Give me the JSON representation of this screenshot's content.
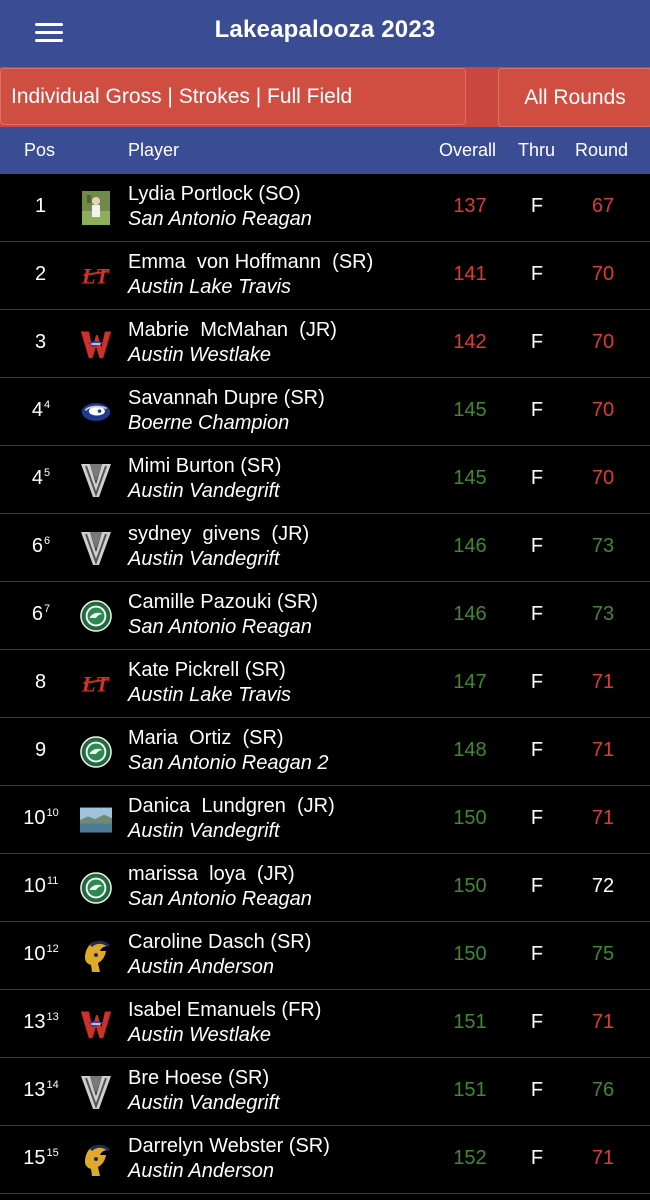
{
  "app": {
    "title": "Lakeapalooza 2023"
  },
  "filters": {
    "left": "Individual Gross | Strokes | Full Field",
    "right": "All Rounds"
  },
  "columns": {
    "pos": "Pos",
    "player": "Player",
    "overall": "Overall",
    "thru": "Thru",
    "round": "Round"
  },
  "colors": {
    "header": "#3a4c93",
    "filter": "#c9473e",
    "under": "#e03a30",
    "over": "#3f8a30",
    "even": "#ffffff"
  },
  "rows": [
    {
      "pos": "1",
      "tie": "",
      "name": "Lydia Portlock (SO)",
      "team": "San Antonio Reagan",
      "overall": "137",
      "overall_color": "red",
      "thru": "F",
      "round": "67",
      "round_color": "red",
      "logo": "player-photo"
    },
    {
      "pos": "2",
      "tie": "",
      "name": "Emma  von Hoffmann  (SR)",
      "team": "Austin Lake Travis",
      "overall": "141",
      "overall_color": "red",
      "thru": "F",
      "round": "70",
      "round_color": "red",
      "logo": "lt-logo"
    },
    {
      "pos": "3",
      "tie": "",
      "name": "Mabrie  McMahan  (JR)",
      "team": "Austin Westlake",
      "overall": "142",
      "overall_color": "red",
      "thru": "F",
      "round": "70",
      "round_color": "red",
      "logo": "w-logo"
    },
    {
      "pos": "4",
      "tie": "4",
      "name": "Savannah Dupre (SR)",
      "team": "Boerne Champion",
      "overall": "145",
      "overall_color": "green",
      "thru": "F",
      "round": "70",
      "round_color": "red",
      "logo": "charger-logo"
    },
    {
      "pos": "4",
      "tie": "5",
      "name": "Mimi Burton (SR)",
      "team": "Austin Vandegrift",
      "overall": "145",
      "overall_color": "green",
      "thru": "F",
      "round": "70",
      "round_color": "red",
      "logo": "v-logo"
    },
    {
      "pos": "6",
      "tie": "6",
      "name": "sydney  givens  (JR)",
      "team": "Austin Vandegrift",
      "overall": "146",
      "overall_color": "green",
      "thru": "F",
      "round": "73",
      "round_color": "green",
      "logo": "v-logo"
    },
    {
      "pos": "6",
      "tie": "7",
      "name": "Camille Pazouki (SR)",
      "team": "San Antonio Reagan",
      "overall": "146",
      "overall_color": "green",
      "thru": "F",
      "round": "73",
      "round_color": "green",
      "logo": "reagan-logo"
    },
    {
      "pos": "8",
      "tie": "",
      "name": "Kate Pickrell (SR)",
      "team": "Austin Lake Travis",
      "overall": "147",
      "overall_color": "green",
      "thru": "F",
      "round": "71",
      "round_color": "red",
      "logo": "lt-logo"
    },
    {
      "pos": "9",
      "tie": "",
      "name": "Maria  Ortiz  (SR)",
      "team": "San Antonio Reagan 2",
      "overall": "148",
      "overall_color": "green",
      "thru": "F",
      "round": "71",
      "round_color": "red",
      "logo": "reagan-logo"
    },
    {
      "pos": "10",
      "tie": "10",
      "name": "Danica  Lundgren  (JR)",
      "team": "Austin Vandegrift",
      "overall": "150",
      "overall_color": "green",
      "thru": "F",
      "round": "71",
      "round_color": "red",
      "logo": "landscape-photo"
    },
    {
      "pos": "10",
      "tie": "11",
      "name": "marissa  loya  (JR)",
      "team": "San Antonio Reagan",
      "overall": "150",
      "overall_color": "green",
      "thru": "F",
      "round": "72",
      "round_color": "white",
      "logo": "reagan-logo"
    },
    {
      "pos": "10",
      "tie": "12",
      "name": "Caroline Dasch (SR)",
      "team": "Austin Anderson",
      "overall": "150",
      "overall_color": "green",
      "thru": "F",
      "round": "75",
      "round_color": "green",
      "logo": "trojan-logo"
    },
    {
      "pos": "13",
      "tie": "13",
      "name": "Isabel Emanuels (FR)",
      "team": "Austin Westlake",
      "overall": "151",
      "overall_color": "green",
      "thru": "F",
      "round": "71",
      "round_color": "red",
      "logo": "w-logo"
    },
    {
      "pos": "13",
      "tie": "14",
      "name": "Bre Hoese (SR)",
      "team": "Austin Vandegrift",
      "overall": "151",
      "overall_color": "green",
      "thru": "F",
      "round": "76",
      "round_color": "green",
      "logo": "v-logo"
    },
    {
      "pos": "15",
      "tie": "15",
      "name": "Darrelyn Webster (SR)",
      "team": "Austin Anderson",
      "overall": "152",
      "overall_color": "green",
      "thru": "F",
      "round": "71",
      "round_color": "red",
      "logo": "trojan-logo"
    }
  ]
}
